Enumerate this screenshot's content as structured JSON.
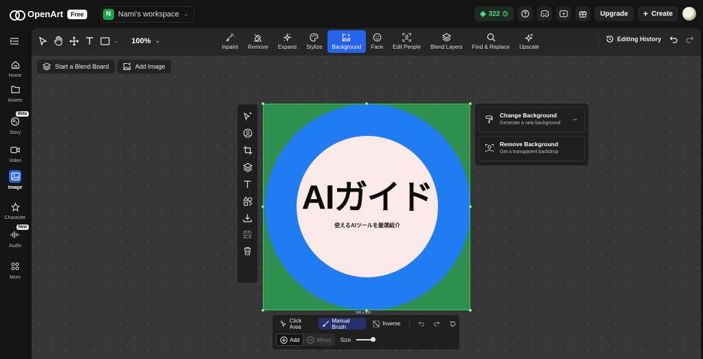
{
  "app": {
    "brand": "OpenArt",
    "plan_badge": "Free",
    "workspace_initial": "N",
    "workspace_name": "Nami's workspace",
    "credits": "322",
    "upgrade_label": "Upgrade",
    "create_label": "Create"
  },
  "sidebar": {
    "items": [
      {
        "label": "Home",
        "icon": "home-icon"
      },
      {
        "label": "Assets",
        "icon": "folder-icon"
      },
      {
        "label": "Story",
        "icon": "story-icon",
        "badge": "Beta"
      },
      {
        "label": "Video",
        "icon": "video-icon"
      },
      {
        "label": "Image",
        "icon": "image-icon",
        "active": true
      },
      {
        "label": "Character",
        "icon": "character-icon"
      },
      {
        "label": "Audio",
        "icon": "audio-icon",
        "badge": "New"
      },
      {
        "label": "More",
        "icon": "more-icon"
      }
    ]
  },
  "toolbar": {
    "zoom": "100%",
    "tools": [
      "Inpaint",
      "Remove",
      "Expand",
      "Stylize",
      "Background",
      "Face",
      "Edit People",
      "Blend Layers",
      "Find & Replace",
      "Upscale"
    ],
    "active_tool": "Background",
    "editing_history": "Editing History"
  },
  "actions": {
    "blend_board": "Start a Blend Board",
    "add_image": "Add Image"
  },
  "canvas": {
    "headline": "AIガイド",
    "subline": "使えるAIツールを厳選紹介",
    "dimensions": "500 x 500",
    "colors": {
      "frame": "#2f8f4e",
      "ring": "#1f7cf2",
      "inner": "#fbe9e7"
    }
  },
  "background_panel": {
    "options": [
      {
        "title": "Change Background",
        "desc": "Generate a new background"
      },
      {
        "title": "Remove Background",
        "desc": "Get a transparent backdrop"
      }
    ]
  },
  "brush_panel": {
    "click_area": "Click Area",
    "manual_brush": "Manual Brush",
    "inverse": "Inverse",
    "add": "Add",
    "minus": "Minus",
    "size_label": "Size",
    "size_level": 0.85
  },
  "theme": {
    "accent": "#2563eb",
    "credits": "#4ade80"
  }
}
